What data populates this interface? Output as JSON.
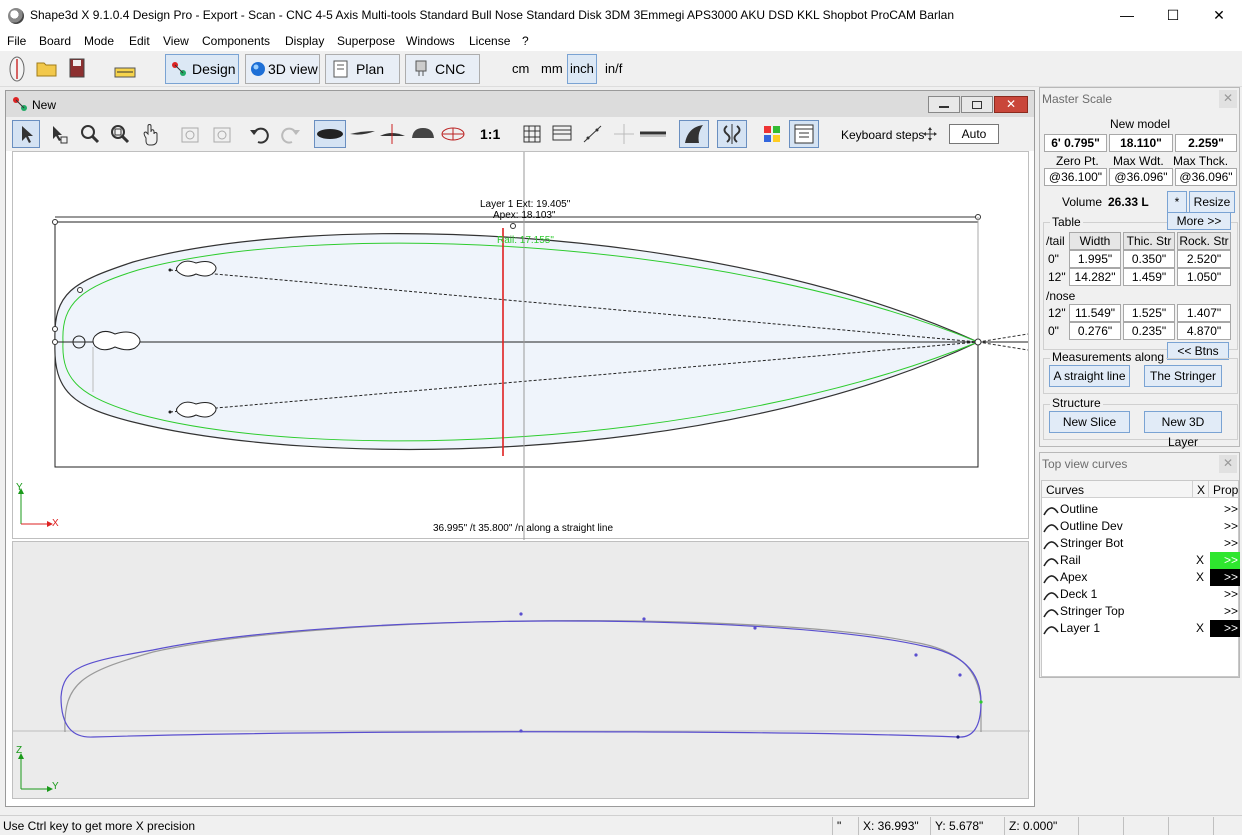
{
  "window": {
    "title": "Shape3d X 9.1.0.4 Design Pro - Export - Scan - CNC 4-5 Axis Multi-tools  Standard Bull Nose Standard Disk 3DM 3Emmegi APS3000 AKU DSD KKL Shopbot ProCAM Barlan",
    "minimize": "—",
    "maximize": "☐",
    "close": "✕"
  },
  "menu": [
    "File",
    "Board",
    "Mode",
    "Edit",
    "View",
    "Components",
    "Display",
    "Superpose",
    "Windows",
    "License",
    "?"
  ],
  "toolbar": {
    "modes": [
      "Design",
      "3D view",
      "Plan",
      "CNC"
    ],
    "active_mode": "Design",
    "units": [
      "cm",
      "mm",
      "inch",
      "in/f"
    ],
    "selected_unit": "inch"
  },
  "design_window": {
    "title": "New",
    "scale_label": "1:1",
    "keyboard_steps_label": "Keyboard steps",
    "auto_label": "Auto"
  },
  "top_view": {
    "layer_label": "Layer 1 Ext: 19.405\"",
    "apex_label": "Apex: 18.103\"",
    "rail_label": "Rail: 17.155\"",
    "measure_label": "36.995\" /t 35.800\" /n along a straight line",
    "axis_y": "Y",
    "axis_x": "X",
    "rail_color": "#2ecc2e",
    "slice_color": "#e02020"
  },
  "side_view": {
    "axis_z": "Z",
    "axis_y": "Y",
    "curve_color": "#5a4fcf"
  },
  "master_scale": {
    "title": "Master Scale",
    "model_name": "New model",
    "length": "6' 0.795\"",
    "max_width": "18.110\"",
    "max_thickness": "2.259\"",
    "labels": [
      "Zero Pt.",
      "Max Wdt.",
      "Max Thck."
    ],
    "positions": [
      "@36.100\"",
      "@36.096\"",
      "@36.096\""
    ],
    "volume_label": "Volume",
    "volume_value": "26.33 L",
    "star_btn": "*",
    "resize_btn": "Resize",
    "table_label": "Table",
    "more_btn": "More >>",
    "tail_label": "/tail",
    "nose_label": "/nose",
    "columns": [
      "Width",
      "Thic. Str",
      "Rock. Str"
    ],
    "tail_rows": [
      {
        "pos": "0\"",
        "values": [
          "1.995\"",
          "0.350\"",
          "2.520\""
        ]
      },
      {
        "pos": "12\"",
        "values": [
          "14.282\"",
          "1.459\"",
          "1.050\""
        ]
      }
    ],
    "nose_rows": [
      {
        "pos": "12\"",
        "values": [
          "11.549\"",
          "1.525\"",
          "1.407\""
        ]
      },
      {
        "pos": "0\"",
        "values": [
          "0.276\"",
          "0.235\"",
          "4.870\""
        ]
      }
    ],
    "btns_btn": "<< Btns",
    "measurements_label": "Measurements along",
    "straight_btn": "A straight line",
    "stringer_btn": "The Stringer",
    "structure_label": "Structure",
    "new_slice_btn": "New Slice",
    "new_3d_layer_btn": "New 3D Layer"
  },
  "curves_panel": {
    "title": "Top view curves",
    "header": {
      "curves": "Curves",
      "x": "X",
      "prop": "Prop"
    },
    "items": [
      {
        "name": "Outline",
        "x": "",
        "prop": ">>",
        "prop_bg": ""
      },
      {
        "name": "Outline Dev",
        "x": "",
        "prop": ">>",
        "prop_bg": ""
      },
      {
        "name": "Stringer Bot",
        "x": "",
        "prop": ">>",
        "prop_bg": ""
      },
      {
        "name": "Rail",
        "x": "X",
        "prop": ">>",
        "prop_bg": "#2ee62e"
      },
      {
        "name": "Apex",
        "x": "X",
        "prop": ">>",
        "prop_bg": "#000000"
      },
      {
        "name": "Deck 1",
        "x": "",
        "prop": ">>",
        "prop_bg": ""
      },
      {
        "name": "Stringer Top",
        "x": "",
        "prop": ">>",
        "prop_bg": ""
      },
      {
        "name": "Layer 1",
        "x": "X",
        "prop": ">>",
        "prop_bg": "#000000"
      }
    ]
  },
  "status": {
    "hint": "Use Ctrl key to get more X precision",
    "unit": "\"",
    "x": "X: 36.993\"",
    "y": "Y: 5.678\"",
    "z": "Z: 0.000\""
  }
}
